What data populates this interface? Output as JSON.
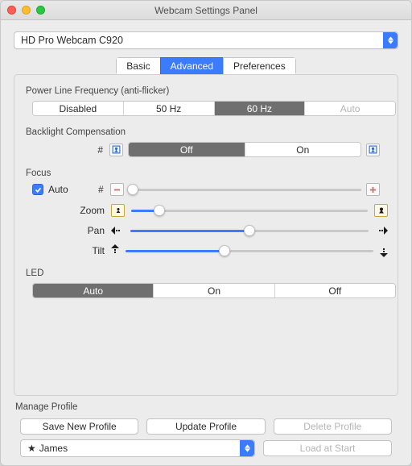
{
  "window": {
    "title": "Webcam Settings Panel"
  },
  "device": {
    "selected": "HD Pro Webcam C920"
  },
  "tabs": {
    "basic": "Basic",
    "advanced": "Advanced",
    "preferences": "Preferences",
    "active": "advanced"
  },
  "powerline": {
    "label": "Power Line Frequency (anti-flicker)",
    "options": {
      "disabled": "Disabled",
      "hz50": "50 Hz",
      "hz60": "60 Hz",
      "auto": "Auto"
    },
    "selected": "60 Hz"
  },
  "backlight": {
    "label": "Backlight Compensation",
    "hash": "#",
    "options": {
      "off": "Off",
      "on": "On"
    },
    "selected": "Off"
  },
  "focus": {
    "label": "Focus",
    "auto_label": "Auto",
    "auto_checked": true,
    "hash": "#",
    "slider_value": 0
  },
  "zoom": {
    "label": "Zoom",
    "value": 12
  },
  "pan": {
    "label": "Pan",
    "value": 50
  },
  "tilt": {
    "label": "Tilt",
    "value": 40
  },
  "led": {
    "label": "LED",
    "options": {
      "auto": "Auto",
      "on": "On",
      "off": "Off"
    },
    "selected": "Auto"
  },
  "profile": {
    "label": "Manage Profile",
    "save": "Save New Profile",
    "update": "Update Profile",
    "delete": "Delete Profile",
    "load": "Load at Start",
    "selected": "James",
    "star": "★"
  }
}
